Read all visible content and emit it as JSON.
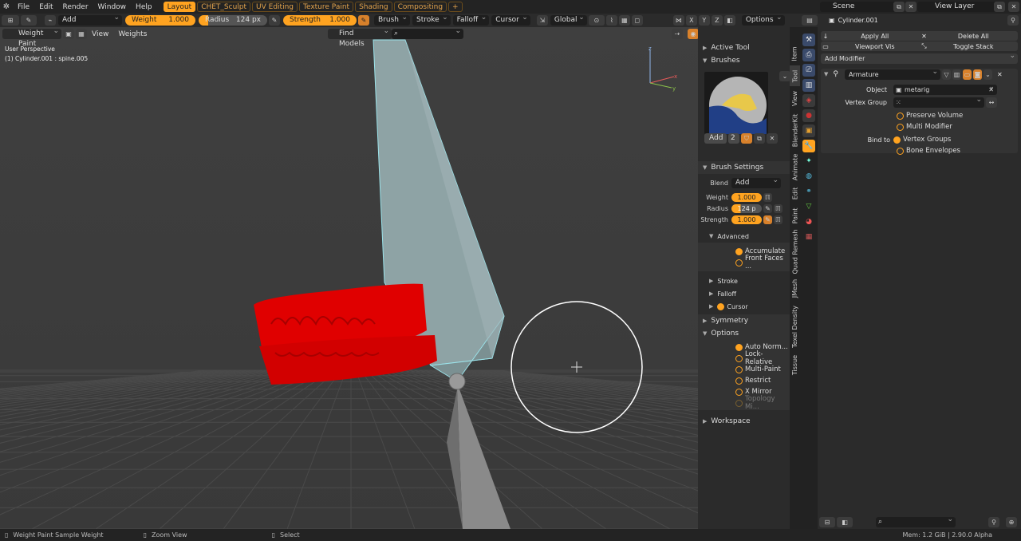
{
  "topbar": {
    "menus": [
      "File",
      "Edit",
      "Render",
      "Window",
      "Help"
    ],
    "workspaces": [
      "Layout",
      "CHET_Sculpt",
      "UV Editing",
      "Texture Paint",
      "Shading",
      "Compositing",
      "+"
    ],
    "scene": "Scene",
    "view_layer": "View Layer"
  },
  "tool_header": {
    "blend_mode": "Add",
    "weight_label": "Weight",
    "weight_value": "1.000",
    "radius_label": "Radius",
    "radius_value": "124 px",
    "strength_label": "Strength",
    "strength_value": "1.000",
    "menus": [
      "Brush",
      "Stroke",
      "Falloff",
      "Cursor"
    ],
    "orientation": "Global",
    "axes": [
      "X",
      "Y",
      "Z"
    ],
    "options": "Options"
  },
  "viewport_header": {
    "mode": "Weight Paint",
    "menus": [
      "View",
      "Weights"
    ],
    "find_models": "Find Models"
  },
  "viewport": {
    "view_name": "User Perspective",
    "object_info": "(1) Cylinder.001 : spine.005",
    "gizmo_axes": [
      "x",
      "y",
      "z"
    ]
  },
  "npanel": {
    "active_tool": "Active Tool",
    "brushes": "Brushes",
    "brush_add": "Add",
    "brush_users": "2",
    "brush_settings": "Brush Settings",
    "blend_label": "Blend",
    "blend_value": "Add",
    "weight_label": "Weight",
    "weight_value": "1.000",
    "radius_label": "Radius",
    "radius_value": "124 p",
    "strength_label": "Strength",
    "strength_value": "1.000",
    "advanced": "Advanced",
    "accumulate": "Accumulate",
    "front_faces": "Front Faces ...",
    "stroke": "Stroke",
    "falloff": "Falloff",
    "cursor": "Cursor",
    "symmetry": "Symmetry",
    "options": "Options",
    "auto_normalize": "Auto Norm...",
    "lock_relative": "Lock-Relative",
    "multi_paint": "Multi-Paint",
    "restrict": "Restrict",
    "x_mirror": "X Mirror",
    "topology_mirror": "Topology Mi...",
    "workspace": "Workspace"
  },
  "sidebar_tabs": [
    "Item",
    "Tool",
    "View",
    "BlenderKit",
    "Animate",
    "Edit",
    "Paint",
    "Quad Remesh",
    "JMesh",
    "Texel Density",
    "Tissue"
  ],
  "properties": {
    "object_name": "Cylinder.001",
    "apply_all": "Apply All",
    "delete_all": "Delete All",
    "viewport_vis": "Viewport Vis",
    "toggle_stack": "Toggle Stack",
    "add_modifier": "Add Modifier",
    "modifier_name": "Armature",
    "object_label": "Object",
    "object_value": "metarig",
    "vertex_group_label": "Vertex Group",
    "preserve_volume": "Preserve Volume",
    "multi_modifier": "Multi Modifier",
    "bind_to_label": "Bind to",
    "vertex_groups": "Vertex Groups",
    "bone_envelopes": "Bone Envelopes"
  },
  "statusbar": {
    "left": "Weight Paint Sample Weight",
    "middle": "Zoom View",
    "right": "Select",
    "mem": "Mem: 1.2 GiB | 2.90.0 Alpha"
  }
}
